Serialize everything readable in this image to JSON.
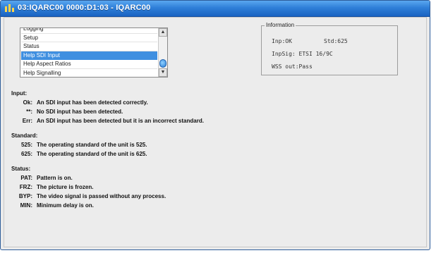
{
  "window": {
    "title": "03:IQARC00  0000:D1:03  - IQARC00"
  },
  "listbox": {
    "items": [
      {
        "label": "Logging"
      },
      {
        "label": "Setup"
      },
      {
        "label": "Status"
      },
      {
        "label": "Help SDI Input",
        "selected": true
      },
      {
        "label": "Help Aspect Ratios"
      },
      {
        "label": "Help Signalling"
      }
    ],
    "scroll_up_glyph": "▲",
    "scroll_down_glyph": "▼"
  },
  "information": {
    "title": "Information",
    "inp": "Inp:OK",
    "std": "Std:625",
    "inpsig": "InpSig: ETSI 16/9C",
    "wss": "WSS out:Pass"
  },
  "help": {
    "input_heading": "Input:",
    "input_rows": [
      {
        "code": "Ok:",
        "desc": "An SDI input has been detected correctly."
      },
      {
        "code": "**:",
        "desc": "No SDI input has been detected."
      },
      {
        "code": "Err:",
        "desc": "An SDI input has been detected but it is an incorrect standard."
      }
    ],
    "standard_heading": "Standard:",
    "standard_rows": [
      {
        "code": "525:",
        "desc": "The operating standard of the unit is 525."
      },
      {
        "code": "625:",
        "desc": "The operating standard of the unit is 625."
      }
    ],
    "status_heading": "Status:",
    "status_rows": [
      {
        "code": "PAT:",
        "desc": "Pattern is on."
      },
      {
        "code": "FRZ:",
        "desc": "The picture is frozen."
      },
      {
        "code": "BYP:",
        "desc": "The video signal is passed without any process."
      },
      {
        "code": "MIN:",
        "desc": "Minimum delay is on."
      }
    ]
  },
  "colors": {
    "titlebar": "#2f7fd8",
    "selection": "#3f8fe0"
  }
}
